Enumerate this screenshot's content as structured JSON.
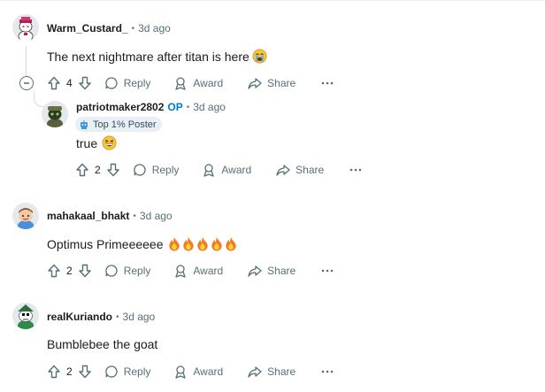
{
  "comments": [
    {
      "username": "Warm_Custard_",
      "time": "3d ago",
      "text": "The next nightmare after titan is here",
      "emojis": [
        "crying-face"
      ],
      "score": "4",
      "reply_label": "Reply",
      "award_label": "Award",
      "share_label": "Share"
    },
    {
      "username": "patriotmaker2802",
      "op_badge": "OP",
      "time": "3d ago",
      "flair": "Top 1% Poster",
      "text": "true",
      "emojis": [
        "grinning-squinting-face"
      ],
      "score": "2",
      "reply_label": "Reply",
      "award_label": "Award",
      "share_label": "Share"
    },
    {
      "username": "mahakaal_bhakt",
      "time": "3d ago",
      "text": "Optimus Primeeeeee",
      "emojis": [
        "fire",
        "fire",
        "fire",
        "fire",
        "fire"
      ],
      "score": "2",
      "reply_label": "Reply",
      "award_label": "Award",
      "share_label": "Share"
    },
    {
      "username": "realKuriando",
      "time": "3d ago",
      "text": "Bumblebee the goat",
      "emojis": [],
      "score": "2",
      "reply_label": "Reply",
      "award_label": "Award",
      "share_label": "Share"
    }
  ],
  "colors": {
    "meta_text": "#576f76",
    "op_blue": "#0079d3",
    "flair_bg": "#e8f0f6",
    "thread_line": "#d7d9dc"
  }
}
